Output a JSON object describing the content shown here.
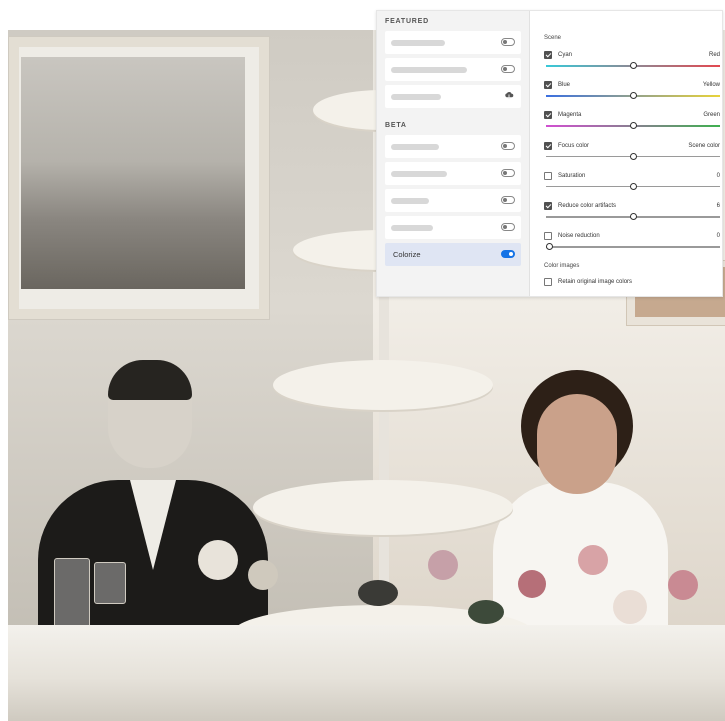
{
  "panel": {
    "featured_label": "FEATURED",
    "featured_items": [
      {
        "kind": "placeholder",
        "icon": "toggle-off"
      },
      {
        "kind": "placeholder",
        "icon": "toggle-off"
      },
      {
        "kind": "placeholder",
        "icon": "cloud-download-icon"
      }
    ],
    "beta_label": "BETA",
    "beta_items": [
      {
        "kind": "placeholder",
        "icon": "toggle-off"
      },
      {
        "kind": "placeholder",
        "icon": "toggle-off"
      },
      {
        "kind": "placeholder",
        "icon": "toggle-off"
      },
      {
        "kind": "placeholder",
        "icon": "toggle-off"
      },
      {
        "kind": "selected",
        "label": "Colorize",
        "icon": "toggle-on"
      }
    ]
  },
  "settings": {
    "section_title": "Scene",
    "controls": [
      {
        "name": "Cyan",
        "checked": true,
        "end_label": "Red",
        "slider_level": 0.5,
        "track_colors": [
          "#38c9d8",
          "#e34850"
        ]
      },
      {
        "name": "Blue",
        "checked": true,
        "end_label": "Yellow",
        "slider_level": 0.5,
        "track_colors": [
          "#3b6fe0",
          "#e8d33a"
        ]
      },
      {
        "name": "Magenta",
        "checked": true,
        "end_label": "Green",
        "slider_level": 0.5,
        "track_colors": [
          "#d14fd1",
          "#3fb04f"
        ]
      },
      {
        "name": "Focus color",
        "checked": true,
        "end_label": "Scene color",
        "slider_level": 0.5,
        "track_colors": [
          "#9a9a9a",
          "#9a9a9a"
        ]
      },
      {
        "name": "Saturation",
        "checked": false,
        "end_label": "0",
        "slider_level": 0.5,
        "track_colors": [
          "#9a9a9a",
          "#9a9a9a"
        ]
      },
      {
        "name": "Reduce color artifacts",
        "checked": true,
        "end_label": "6",
        "slider_level": 0.5,
        "track_colors": [
          "#9a9a9a",
          "#9a9a9a"
        ]
      },
      {
        "name": "Noise reduction",
        "checked": false,
        "end_label": "0",
        "slider_level": 0.0,
        "track_colors": [
          "#9a9a9a",
          "#9a9a9a"
        ]
      }
    ],
    "color_images_title": "Color images",
    "retain_label": "Retain original image colors",
    "retain_checked": false
  },
  "colors": {
    "accent": "#1473e6"
  }
}
